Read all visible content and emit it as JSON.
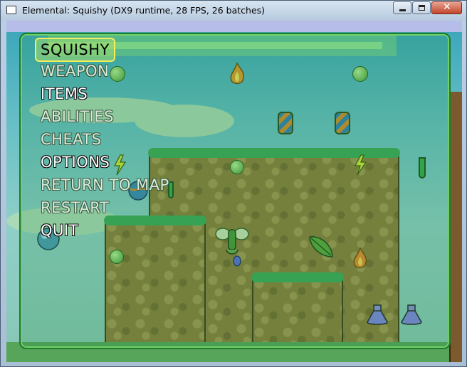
{
  "window": {
    "title": "Elemental: Squishy (DX9 runtime, 28 FPS, 26 batches)",
    "buttons": {
      "minimize": "minimize-icon",
      "maximize": "maximize-icon",
      "close": "close-icon"
    }
  },
  "menu": {
    "items": [
      {
        "label": "SQUISHY",
        "state": "selected"
      },
      {
        "label": "WEAPON",
        "state": "dim"
      },
      {
        "label": "ITEMS",
        "state": "bright"
      },
      {
        "label": "ABILITIES",
        "state": "dim"
      },
      {
        "label": "CHEATS",
        "state": "dim"
      },
      {
        "label": "OPTIONS",
        "state": "bright"
      },
      {
        "label": "RETURN TO MAP",
        "state": "dim"
      },
      {
        "label": "RESTART",
        "state": "dim"
      },
      {
        "label": "QUIT",
        "state": "bright"
      }
    ]
  },
  "colors": {
    "sky_top": "#38a5b9",
    "grass": "#3ea85a",
    "dirt": "#8e7d3e",
    "menu_highlight_border": "#f2ee5c"
  },
  "scene_icons": [
    "fire-icon",
    "lightning-icon",
    "leaf-icon",
    "barrel-icon",
    "potion-icon",
    "vial-icon",
    "orb-icon",
    "squishy-character-icon"
  ]
}
